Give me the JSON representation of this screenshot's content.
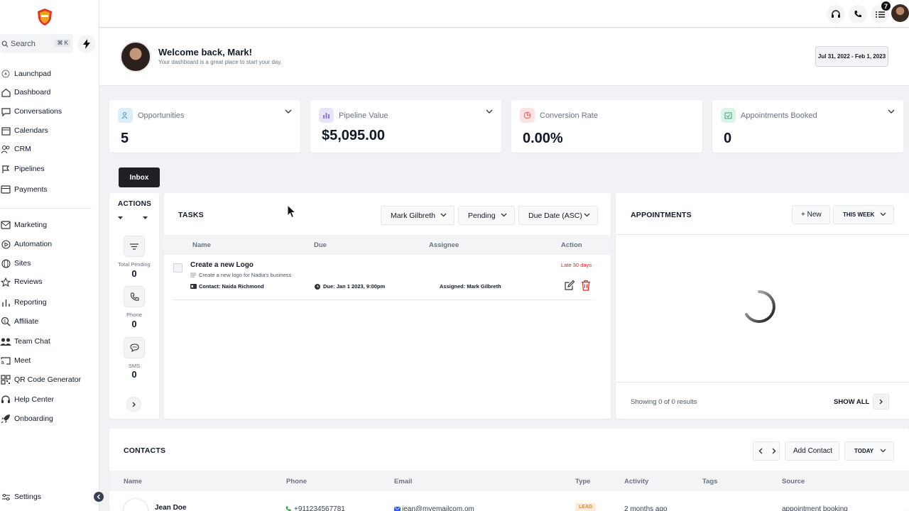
{
  "sidebar": {
    "search": {
      "label": "Search",
      "shortcut": "⌘ K"
    },
    "items": [
      {
        "label": "Launchpad",
        "icon": "launchpad-icon"
      },
      {
        "label": "Dashboard",
        "icon": "home-icon"
      },
      {
        "label": "Conversations",
        "icon": "chat-icon"
      },
      {
        "label": "Calendars",
        "icon": "calendar-icon"
      },
      {
        "label": "CRM",
        "icon": "users-icon"
      },
      {
        "label": "Pipelines",
        "icon": "flag-icon"
      },
      {
        "label": "Payments",
        "icon": "card-icon"
      },
      {
        "label": "Marketing",
        "icon": "mail-icon"
      },
      {
        "label": "Automation",
        "icon": "play-icon"
      },
      {
        "label": "Sites",
        "icon": "globe-icon"
      },
      {
        "label": "Reviews",
        "icon": "star-icon"
      },
      {
        "label": "Reporting",
        "icon": "bar-chart-icon"
      },
      {
        "label": "Affiliate",
        "icon": "affiliate-icon"
      },
      {
        "label": "Team Chat",
        "icon": "team-icon"
      },
      {
        "label": "Meet",
        "icon": "cast-icon"
      },
      {
        "label": "QR Code Generator",
        "icon": "qr-icon"
      },
      {
        "label": "Help Center",
        "icon": "headset-icon"
      },
      {
        "label": "Onboarding",
        "icon": "rocket-icon"
      }
    ],
    "settings": "Settings"
  },
  "header": {
    "notification_count": "7"
  },
  "welcome": {
    "title": "Welcome back, Mark!",
    "subtitle": "Your dashboard is a great place to start your day.",
    "date_range": "Jul 31, 2022 - Feb 1, 2023"
  },
  "stats": [
    {
      "label": "Opportunities",
      "value": "5",
      "color": "#3b9ad9"
    },
    {
      "label": "Pipeline Value",
      "value": "$5,095.00",
      "color": "#8b7ad6"
    },
    {
      "label": "Conversion Rate",
      "value": "0.00%",
      "color": "#e06b6b"
    },
    {
      "label": "Appointments Booked",
      "value": "0",
      "color": "#3fae7a"
    }
  ],
  "inbox_label": "Inbox",
  "actions": {
    "title": "ACTIONS",
    "items": [
      {
        "label": "Total Pending",
        "value": "0"
      },
      {
        "label": "Phone",
        "value": "0"
      },
      {
        "label": "SMS",
        "value": "0"
      }
    ]
  },
  "tasks": {
    "title": "TASKS",
    "filters": [
      "Mark Gilbreth",
      "Pending",
      "Due Date (ASC)"
    ],
    "columns": [
      "Name",
      "Due",
      "Assignee",
      "Action"
    ],
    "rows": [
      {
        "name": "Create a new Logo",
        "description": "Create a new logo for Nadia's business",
        "contact": "Contact: Naida Richmond",
        "due": "Due: Jan 1 2023, 9:00pm",
        "assigned": "Assigned: Mark Gilbreth",
        "status": "Late 30 days"
      }
    ]
  },
  "appointments": {
    "title": "APPOINTMENTS",
    "new_label": "+ New",
    "range_label": "THIS WEEK",
    "showing": "Showing 0 of 0 results",
    "show_all": "SHOW ALL"
  },
  "contacts": {
    "title": "CONTACTS",
    "add_label": "Add Contact",
    "range_label": "TODAY",
    "columns": [
      "Name",
      "Phone",
      "Email",
      "Type",
      "Activity",
      "Tags",
      "Source"
    ],
    "rows": [
      {
        "name": "Jean Doe",
        "phone": "+911234567781",
        "email": "jean@myemailcom.om",
        "type": "LEAD",
        "activity": "2 months ago",
        "tags": "",
        "source": "appointment booking"
      }
    ]
  }
}
